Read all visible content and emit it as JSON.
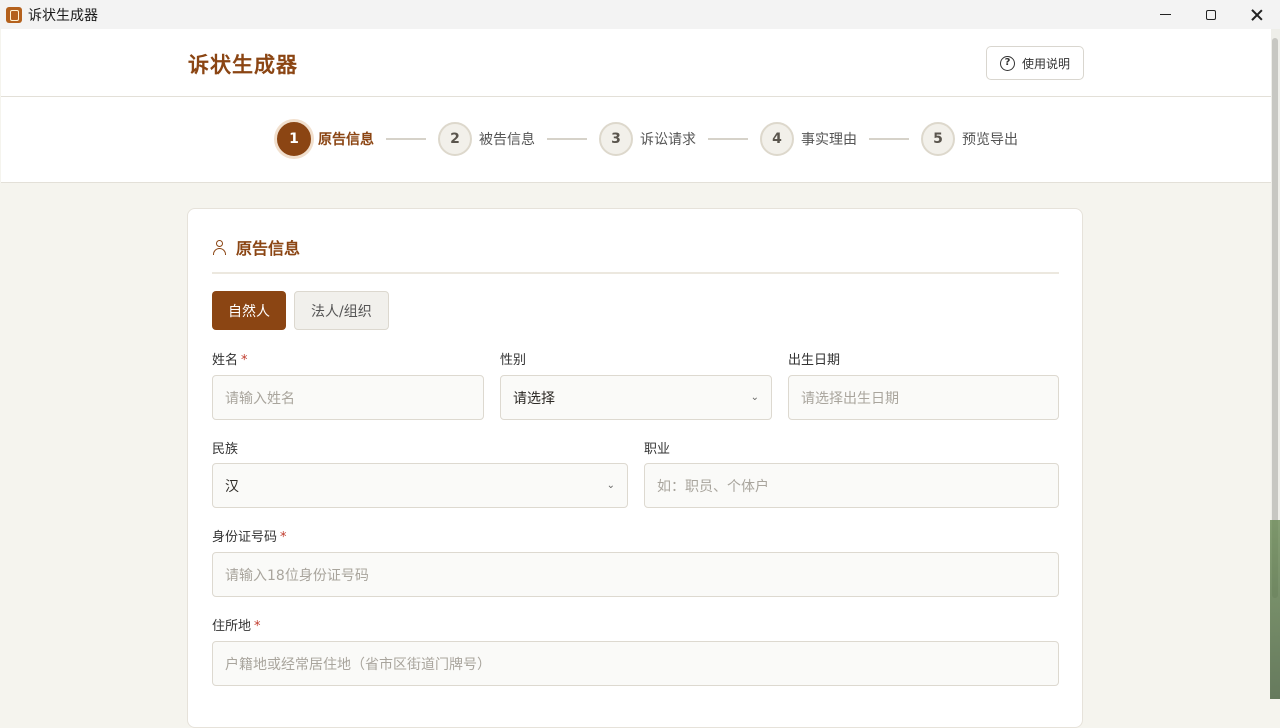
{
  "window": {
    "title": "诉状生成器"
  },
  "header": {
    "brand": "诉状生成器",
    "help_label": "使用说明"
  },
  "steps": [
    {
      "num": "1",
      "label": "原告信息"
    },
    {
      "num": "2",
      "label": "被告信息"
    },
    {
      "num": "3",
      "label": "诉讼请求"
    },
    {
      "num": "4",
      "label": "事实理由"
    },
    {
      "num": "5",
      "label": "预览导出"
    }
  ],
  "card": {
    "title": "原告信息",
    "toggle_person": "自然人",
    "toggle_org": "法人/组织"
  },
  "form": {
    "name_label": "姓名",
    "name_placeholder": "请输入姓名",
    "gender_label": "性别",
    "gender_value": "请选择",
    "birth_label": "出生日期",
    "birth_placeholder": "请选择出生日期",
    "ethnicity_label": "民族",
    "ethnicity_value": "汉",
    "job_label": "职业",
    "job_placeholder": "如：职员、个体户",
    "id_label": "身份证号码",
    "id_placeholder": "请输入18位身份证号码",
    "address_label": "住所地",
    "address_placeholder": "户籍地或经常居住地（省市区街道门牌号）",
    "required_mark": "*"
  },
  "colors": {
    "accent": "#8b4513",
    "required": "#c0392b"
  }
}
